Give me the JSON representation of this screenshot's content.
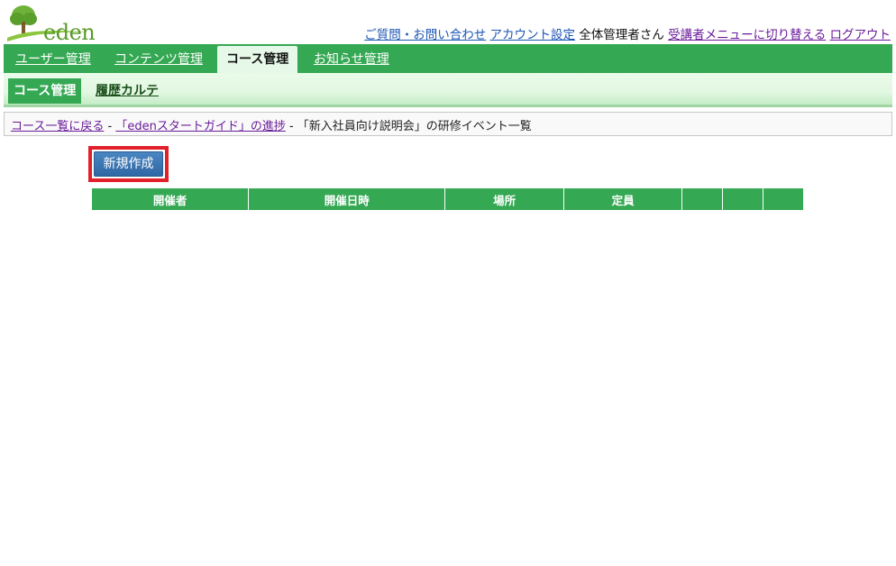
{
  "header": {
    "logo_text": "eden",
    "links": {
      "faq": "ご質問・お問い合わせ",
      "account": "アカウント設定",
      "user": "全体管理者さん",
      "switch_menu": "受講者メニューに切り替える",
      "logout": "ログアウト"
    }
  },
  "main_nav": {
    "tabs": [
      {
        "label": "ユーザー管理"
      },
      {
        "label": "コンテンツ管理"
      },
      {
        "label": "コース管理"
      },
      {
        "label": "お知らせ管理"
      }
    ],
    "active": "コース管理"
  },
  "sub_nav": {
    "active_label": "コース管理",
    "item_label": "履歴カルテ"
  },
  "breadcrumb": {
    "back_link": "コース一覧に戻る",
    "sep": " - ",
    "progress_link": "「edenスタートガイド」の進捗",
    "current": "「新入社員向け説明会」の研修イベント一覧"
  },
  "actions": {
    "new_button": "新規作成"
  },
  "table": {
    "columns": [
      "開催者",
      "開催日時",
      "場所",
      "定員",
      "",
      "",
      ""
    ]
  },
  "colors": {
    "primary_green": "#35a853",
    "button_blue": "#3a77b4",
    "highlight_red": "#e0202a",
    "link_blue": "#1c56b4",
    "link_visited": "#6a1b9a"
  },
  "icons": {
    "logo": "tree-logo-icon"
  }
}
